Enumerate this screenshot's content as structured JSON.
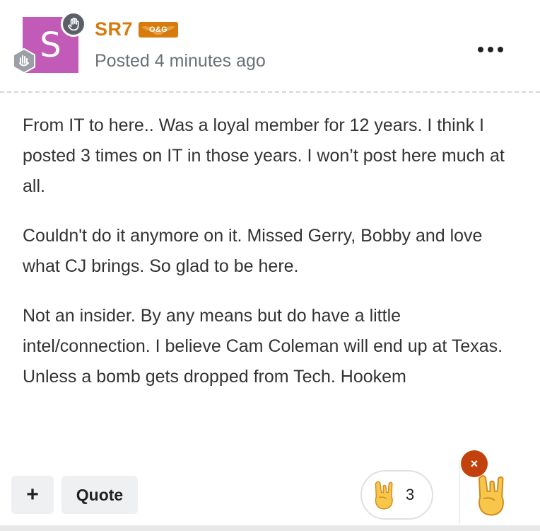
{
  "author": {
    "initial": "S",
    "name": "SR7",
    "rank_badge": "O&G",
    "posted": "Posted 4 minutes ago"
  },
  "colors": {
    "accent": "#d77b0e",
    "avatar_bg": "#c15bb7",
    "close_badge": "#c2410c"
  },
  "icons": {
    "top_badge": "hand-icon",
    "left_badge": "wave-hand-icon",
    "more": "ellipsis-icon",
    "reaction": "rock-on-hand-icon",
    "close": "close-icon"
  },
  "content": {
    "paragraphs": [
      "From IT to here.. Was a loyal member for 12 years. I think I posted 3 times on IT in those years. I won’t post here much at all.",
      "Couldn't do it anymore on it. Missed Gerry, Bobby and love what CJ brings. So glad to be here.",
      "Not an insider. By any means but do have a little intel/connection. I believe Cam Coleman will end up at Texas. Unless a bomb gets dropped from Tech. Hookem"
    ]
  },
  "footer": {
    "plus_label": "+",
    "quote_label": "Quote",
    "reaction_count": "3",
    "close_label": "×"
  }
}
